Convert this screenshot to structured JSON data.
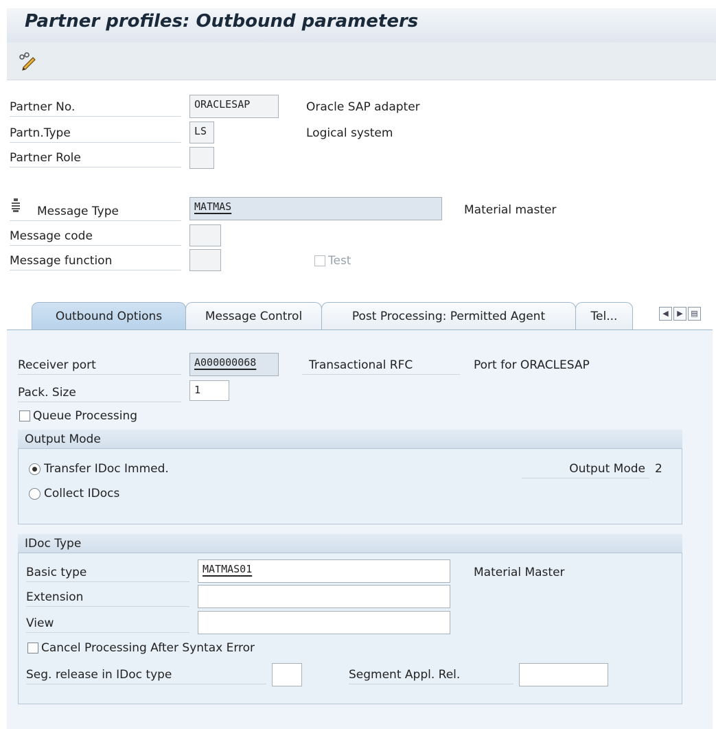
{
  "window": {
    "title": "Partner profiles: Outbound parameters"
  },
  "toolbar": {
    "edit_icon": "pencil-glasses-icon"
  },
  "header": {
    "partner_no_label": "Partner No.",
    "partner_no_value": "ORACLESAP",
    "partner_no_desc": "Oracle SAP adapter",
    "partner_type_label": "Partn.Type",
    "partner_type_value": "LS",
    "partner_type_desc": "Logical system",
    "partner_role_label": "Partner Role",
    "partner_role_value": "",
    "message_type_label": "Message Type",
    "message_type_value": "MATMAS",
    "message_type_desc": "Material master",
    "message_code_label": "Message code",
    "message_code_value": "",
    "message_function_label": "Message function",
    "message_function_value": "",
    "test_label": "Test"
  },
  "tabs": [
    {
      "label": "Outbound Options",
      "active": true
    },
    {
      "label": "Message Control",
      "active": false
    },
    {
      "label": "Post Processing: Permitted Agent",
      "active": false
    },
    {
      "label": "Tel...",
      "active": false
    }
  ],
  "outbound": {
    "receiver_port_label": "Receiver port",
    "receiver_port_value": "A000000068",
    "receiver_port_type": "Transactional RFC",
    "receiver_port_desc": "Port for ORACLESAP",
    "pack_size_label": "Pack. Size",
    "pack_size_value": "1",
    "queue_processing_label": "Queue Processing",
    "output_mode": {
      "title": "Output Mode",
      "transfer_label": "Transfer IDoc Immed.",
      "collect_label": "Collect IDocs",
      "output_mode_label": "Output Mode",
      "output_mode_value": "2",
      "selected": "transfer"
    },
    "idoc_type": {
      "title": "IDoc Type",
      "basic_type_label": "Basic type",
      "basic_type_value": "MATMAS01",
      "basic_type_desc": "Material Master",
      "extension_label": "Extension",
      "extension_value": "",
      "view_label": "View",
      "view_value": "",
      "cancel_label": "Cancel Processing After Syntax Error",
      "seg_release_label": "Seg. release in IDoc type",
      "seg_release_value": "",
      "segment_appl_label": "Segment Appl. Rel.",
      "segment_appl_value": ""
    }
  }
}
